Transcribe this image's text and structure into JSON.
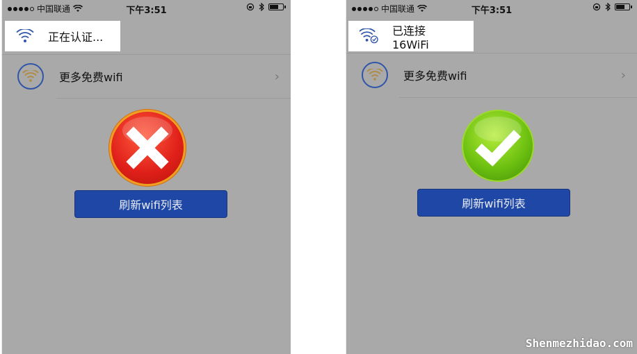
{
  "status_bar": {
    "carrier": "中国联通",
    "time": "下午3:51"
  },
  "left_screen": {
    "toast_text": "正在认证...",
    "more_wifi_label": "更多免费wifi",
    "result_icon": "cross-icon",
    "refresh_button_label": "刷新wifi列表"
  },
  "right_screen": {
    "toast_text": "已连接16WiFi",
    "more_wifi_label": "更多免费wifi",
    "result_icon": "checkmark-icon",
    "refresh_button_label": "刷新wifi列表"
  },
  "watermark": "Shenmezhidao.com",
  "colors": {
    "screen_bg": "#a9a9a9",
    "button_bg": "#1f48a6",
    "fail_red": "#e0201a",
    "success_green": "#6cc010",
    "wifi_blue": "#2f54a8",
    "wifi_gold": "#b08a40"
  }
}
